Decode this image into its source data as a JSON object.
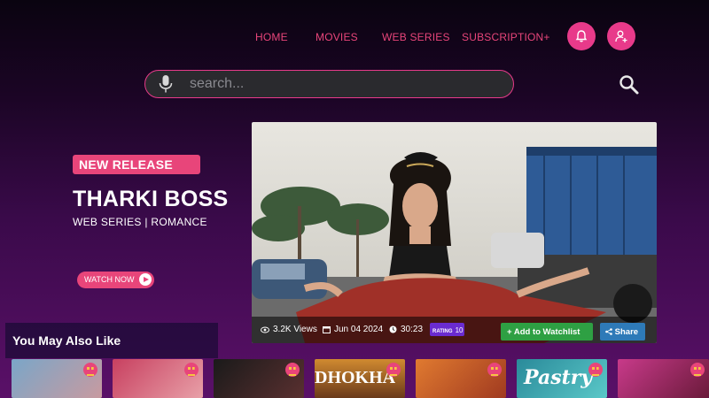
{
  "nav": {
    "links": [
      "HOME",
      "MOVIES",
      "WEB SERIES",
      "SUBSCRIPTION+"
    ],
    "bell_icon": "bell-icon",
    "profile_icon": "add-user-icon",
    "accent": "#e83a8a"
  },
  "search": {
    "placeholder": "search...",
    "mic_icon": "microphone-icon",
    "search_icon": "magnifier-icon"
  },
  "featured": {
    "badge": "NEW RELEASE",
    "title": "THARKI BOSS",
    "genre": "WEB SERIES | ROMANCE",
    "watch_label": "WATCH NOW",
    "views": "3.2K Views",
    "date": "Jun 04 2024",
    "duration": "30:23",
    "rating_label": "RATING",
    "rating_value": "10",
    "watchlist_label": "Add to Watchlist",
    "share_label": "Share"
  },
  "section": {
    "title": "You May Also Like"
  },
  "cards": [
    {
      "caption": ""
    },
    {
      "caption": ""
    },
    {
      "caption": ""
    },
    {
      "caption": "DHOKHA"
    },
    {
      "caption": ""
    },
    {
      "caption": "Pastry"
    },
    {
      "caption": ""
    }
  ]
}
